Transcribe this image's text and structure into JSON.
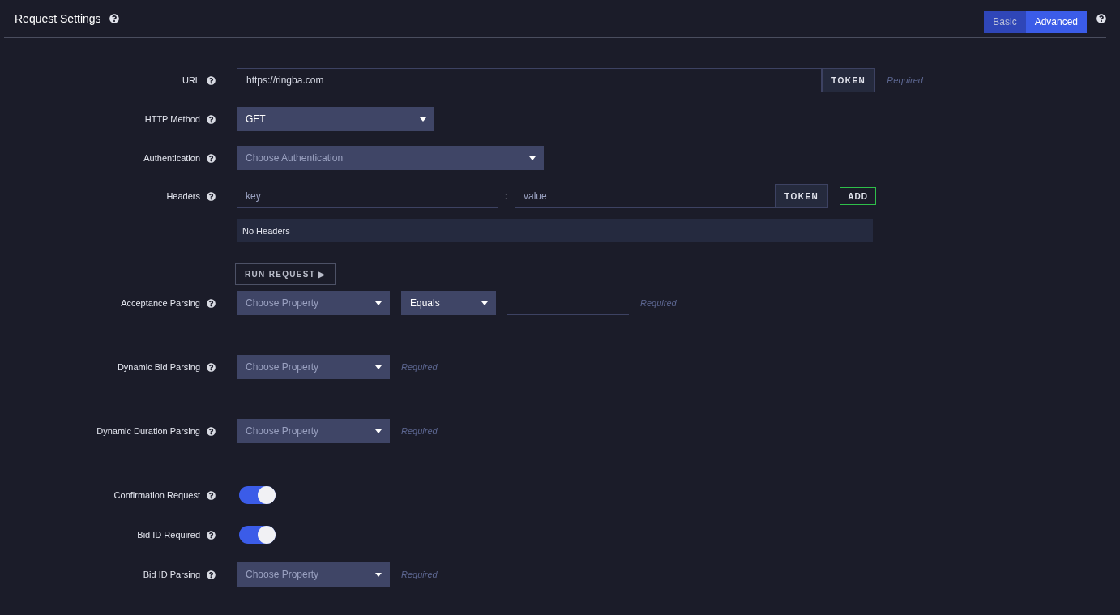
{
  "header": {
    "title": "Request Settings",
    "modes": [
      {
        "label": "Basic",
        "selected": false
      },
      {
        "label": "Advanced",
        "selected": true
      }
    ]
  },
  "rows": [
    {
      "kind": "url",
      "label": "URL",
      "value": "https://ringba.com",
      "token": "TOKEN",
      "hint": "Required"
    },
    {
      "kind": "method",
      "label": "HTTP Method",
      "value": "GET"
    },
    {
      "kind": "auth",
      "label": "Authentication",
      "placeholder": "Choose Authentication"
    },
    {
      "kind": "headers",
      "label": "Headers",
      "key_placeholder": "key",
      "separator": ":",
      "value_placeholder": "value",
      "token": "TOKEN",
      "add": "ADD",
      "empty": "No Headers",
      "run": "RUN REQUEST ▶"
    },
    {
      "kind": "acceptance",
      "label": "Acceptance Parsing",
      "placeholder": "Choose Property",
      "operator": "Equals",
      "hint": "Required"
    },
    {
      "kind": "property",
      "label": "Dynamic Bid Parsing",
      "placeholder": "Choose Property",
      "hint": "Required"
    },
    {
      "kind": "property",
      "label": "Dynamic Duration Parsing",
      "placeholder": "Choose Property",
      "hint": "Required"
    },
    {
      "kind": "toggle",
      "label": "Confirmation Request",
      "on": true
    },
    {
      "kind": "toggle",
      "label": "Bid ID Required",
      "on": true
    },
    {
      "kind": "property",
      "label": "Bid ID Parsing",
      "placeholder": "Choose Property",
      "hint": "Required"
    }
  ]
}
